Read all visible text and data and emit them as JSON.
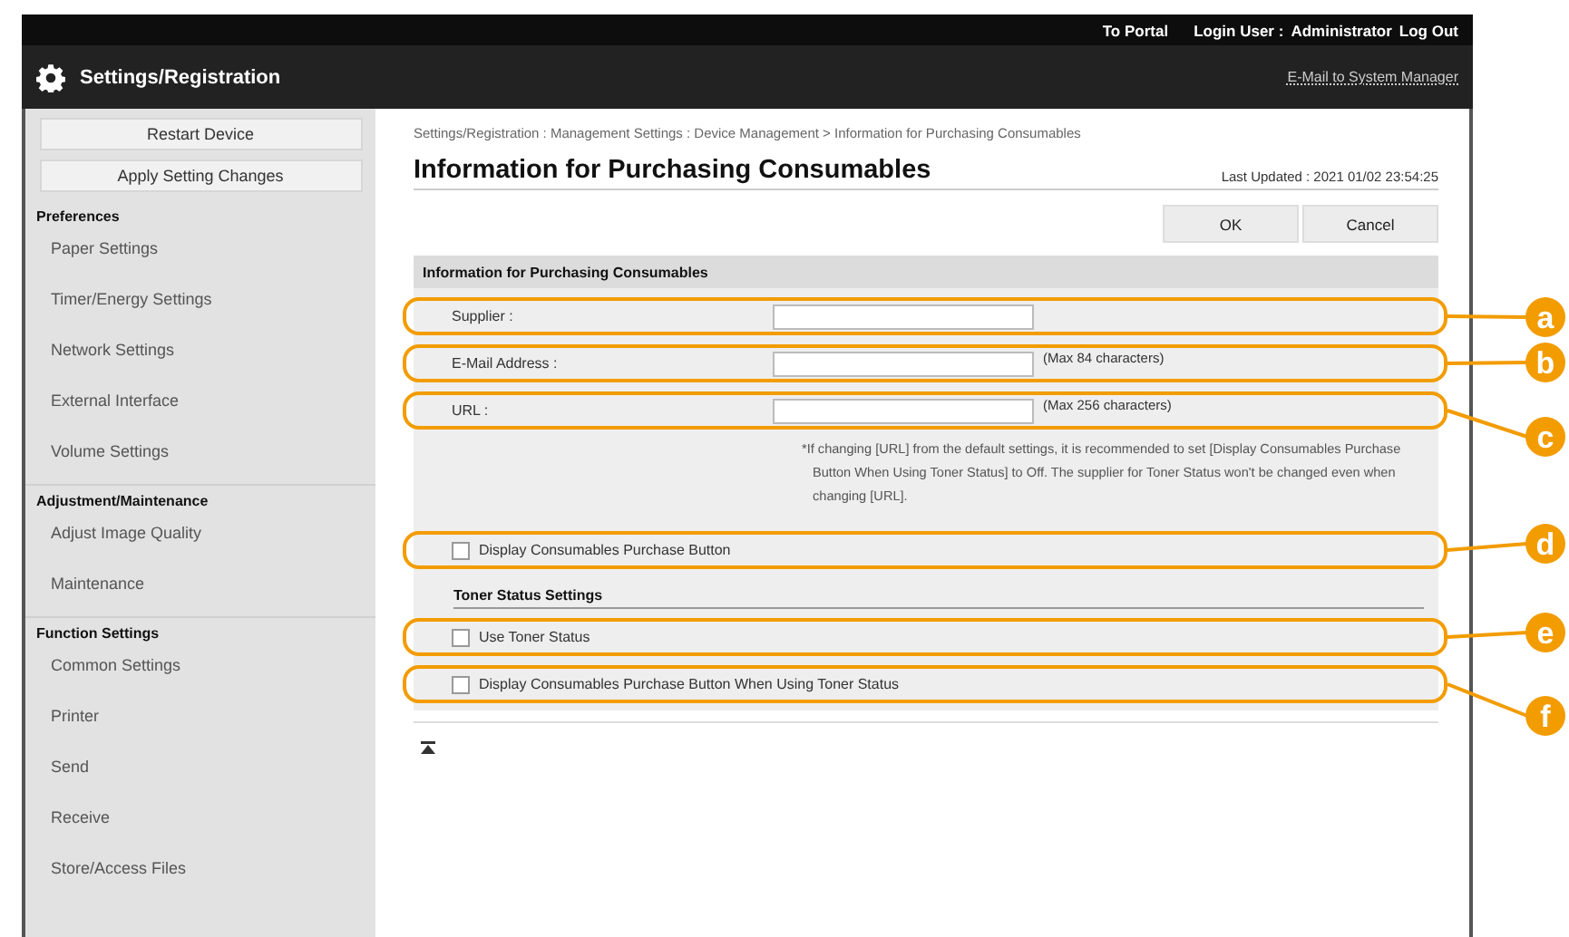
{
  "header": {
    "portal_link": "To Portal",
    "login_label": "Login User :",
    "user": "Administrator",
    "logout_link": "Log Out",
    "title": "Settings/Registration",
    "email_link": "E-Mail to System Manager"
  },
  "sidebar": {
    "buttons": [
      "Restart Device",
      "Apply Setting Changes"
    ],
    "groups": [
      {
        "title": "Preferences",
        "items": [
          "Paper Settings",
          "Timer/Energy Settings",
          "Network Settings",
          "External Interface",
          "Volume Settings"
        ]
      },
      {
        "title": "Adjustment/Maintenance",
        "items": [
          "Adjust Image Quality",
          "Maintenance"
        ]
      },
      {
        "title": "Function Settings",
        "items": [
          "Common Settings",
          "Printer",
          "Send",
          "Receive",
          "Store/Access Files"
        ]
      }
    ]
  },
  "main": {
    "breadcrumb": "Settings/Registration : Management Settings : Device Management > Information for Purchasing Consumables",
    "title": "Information for Purchasing Consumables",
    "last_updated": "Last Updated : 2021 01/02 23:54:25",
    "buttons": [
      "OK",
      "Cancel"
    ],
    "section_title": "Information for Purchasing Consumables",
    "rows": [
      {
        "kind": "field",
        "label": "Supplier :",
        "callout": "a"
      },
      {
        "kind": "field",
        "label": "E-Mail Address :",
        "hint": "(Max 84 characters)",
        "callout": "b"
      },
      {
        "kind": "field",
        "label": "URL :",
        "hint": "(Max 256 characters)",
        "callout": "c"
      },
      {
        "kind": "note",
        "text": "*If changing [URL] from the default settings, it is recommended to set [Display Consumables Purchase Button When Using Toner Status] to Off. The supplier for Toner Status won't be changed even when changing [URL]."
      },
      {
        "kind": "checkbox",
        "label": "Display Consumables Purchase Button",
        "checked": false,
        "callout": "d"
      },
      {
        "kind": "heading",
        "text": "Toner Status Settings"
      },
      {
        "kind": "checkbox",
        "label": "Use Toner Status",
        "checked": false,
        "callout": "e"
      },
      {
        "kind": "checkbox",
        "label": "Display Consumables Purchase Button When Using Toner Status",
        "checked": false,
        "callout": "f"
      }
    ]
  }
}
